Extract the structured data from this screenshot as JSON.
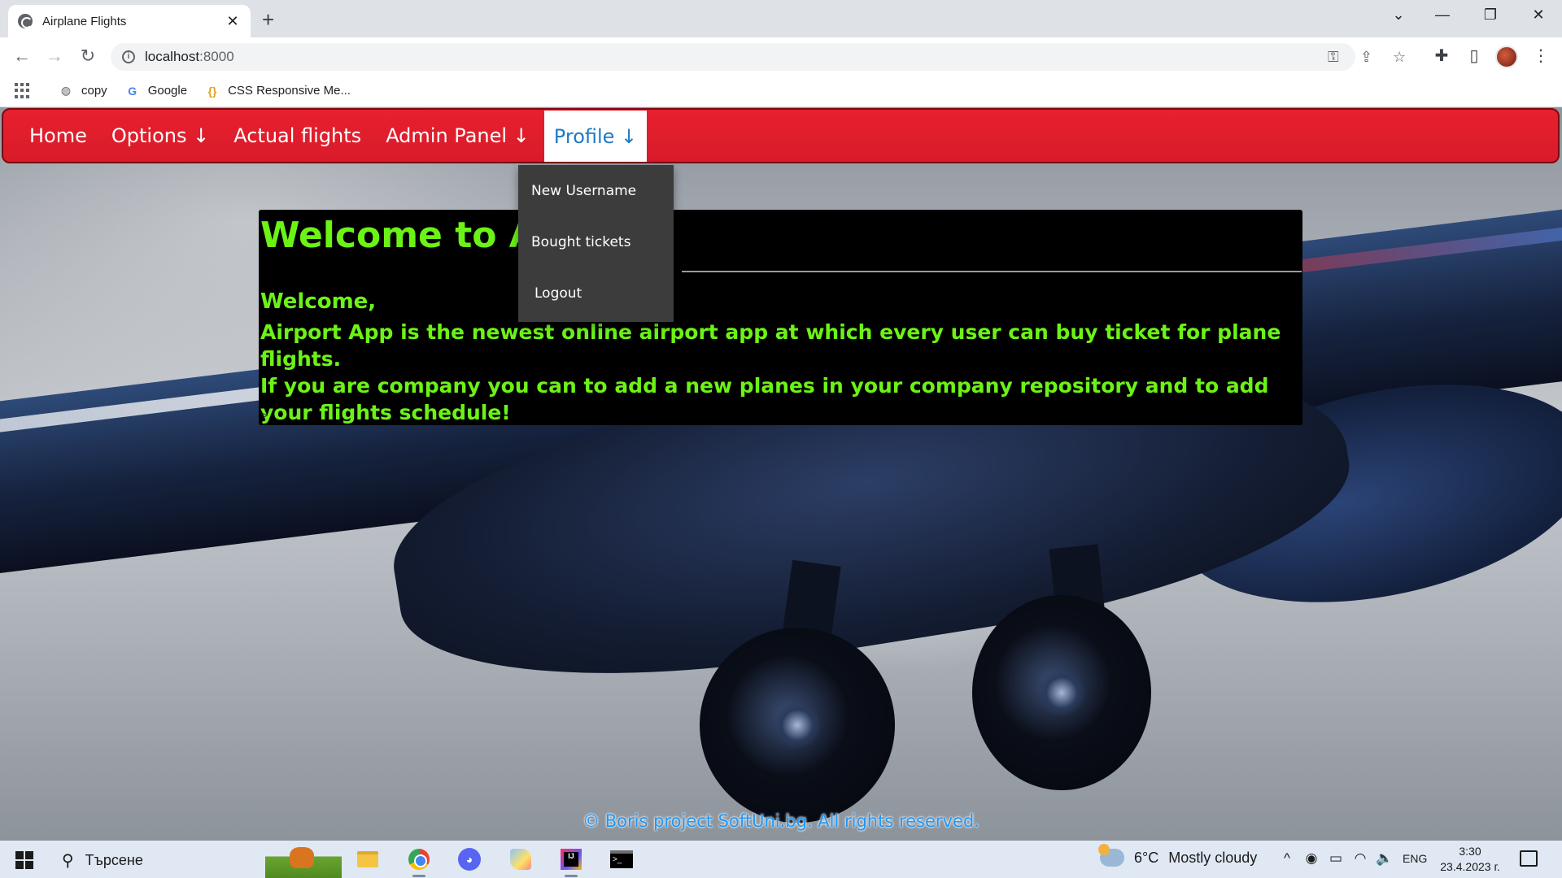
{
  "browser": {
    "tab_title": "Airplane Flights",
    "tab_close": "✕",
    "new_tab": "+",
    "url_host": "localhost",
    "url_port": ":8000",
    "bookmarks": [
      {
        "label": "copy",
        "icon": "globe-icon"
      },
      {
        "label": "Google",
        "icon": "google-icon"
      },
      {
        "label": "CSS Responsive Me...",
        "icon": "code-braces-icon"
      }
    ]
  },
  "nav": {
    "items": [
      "Home",
      "Options ↓",
      "Actual flights",
      "Admin Panel ↓",
      "Profile ↓"
    ],
    "active_index": 4,
    "accent_color": "#e8202e",
    "active_text_color": "#1e7ac8"
  },
  "profile_menu": {
    "items": [
      "New Username",
      "Bought tickets",
      "Logout"
    ]
  },
  "welcome": {
    "title": "Welcome to Air",
    "greeting": "Welcome,",
    "line1": "Airport App is the newest online airport app at which every user can buy ticket for plane flights.",
    "line2": "If you are company you can to add a new planes in your company repository and to add your flights schedule!",
    "caret": ">",
    "text_color": "#6cf316"
  },
  "footer": {
    "text": "© Boris project SoftUni.bg. All rights reserved."
  },
  "taskbar": {
    "search_placeholder": "Търсене",
    "weather_temp": "6°C",
    "weather_desc": "Mostly cloudy",
    "language": "ENG",
    "time": "3:30",
    "date": "23.4.2023 г."
  }
}
